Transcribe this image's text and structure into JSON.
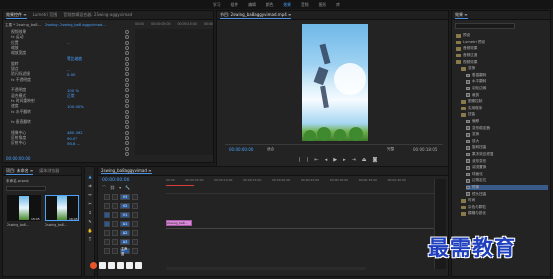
{
  "workspace_menu": [
    "学习",
    "组件",
    "编辑",
    "颜色",
    "效果",
    "音频",
    "图形",
    "库"
  ],
  "workspace_active": 4,
  "effect_controls": {
    "tabs": [
      "效果控件 ≡",
      "Lumetri 范围",
      "音频剪辑混合器: 2Swing-aggyvimad"
    ],
    "source_clip": "主要 * 2swing_ba8...",
    "seq_clip": "2swing: 2swing_ba8 aggyvimad...",
    "times": [
      "00:00",
      "00:00:05:00",
      "00:00:10:00",
      "00:00"
    ],
    "rows": [
      {
        "label": "视频效果",
        "val": ""
      },
      {
        "label": "fx  运动",
        "val": ""
      },
      {
        "label": "位置",
        "val": "..."
      },
      {
        "label": "缩放",
        "val": ""
      },
      {
        "label": "缩放宽度",
        "val": ""
      },
      {
        "label": "",
        "val": "等比缩放"
      },
      {
        "label": "旋转",
        "val": ""
      },
      {
        "label": "锚点",
        "val": "..."
      },
      {
        "label": "防闪烁滤镜",
        "val": "0.00"
      },
      {
        "label": "fx  不透明度",
        "val": ""
      },
      {
        "label": "",
        "val": ""
      },
      {
        "label": "不透明度",
        "val": "100 %"
      },
      {
        "label": "混合模式",
        "val": "正常"
      },
      {
        "label": "fx  时间重映射",
        "val": ""
      },
      {
        "label": "速度",
        "val": "100.00%"
      },
      {
        "label": "fx  水平翻转",
        "val": ""
      },
      {
        "label": "",
        "val": ""
      },
      {
        "label": "fx  垂直翻转",
        "val": ""
      },
      {
        "label": "",
        "val": ""
      },
      {
        "label": "镜像中心",
        "val": "480  492"
      },
      {
        "label": "反射角度",
        "val": "90.0°"
      },
      {
        "label": "反射中心",
        "val": "56.8 ..."
      },
      {
        "label": "",
        "val": ""
      },
      {
        "label": "",
        "val": ""
      }
    ],
    "timecode": "00:00:00:00"
  },
  "program_monitor": {
    "tab": "节目: 2swing_ba8aggyvimad.mp4 ≡",
    "timecode_left": "00:00:00:00",
    "fit": "适合",
    "full": "完整",
    "timecode_right": "00:00:18:05"
  },
  "effects_panel": {
    "title": "效果 ≡",
    "items": [
      {
        "label": "预设",
        "type": "folder",
        "indent": 0
      },
      {
        "label": "Lumetri 预设",
        "type": "folder",
        "indent": 0
      },
      {
        "label": "音频效果",
        "type": "folder",
        "indent": 0
      },
      {
        "label": "音频过渡",
        "type": "folder",
        "indent": 0
      },
      {
        "label": "视频效果",
        "type": "folder",
        "indent": 0
      },
      {
        "label": "变换",
        "type": "folder",
        "indent": 1
      },
      {
        "label": "垂直翻转",
        "type": "fx",
        "indent": 2
      },
      {
        "label": "水平翻转",
        "type": "fx",
        "indent": 2
      },
      {
        "label": "羽化边缘",
        "type": "fx",
        "indent": 2
      },
      {
        "label": "裁剪",
        "type": "fx",
        "indent": 2
      },
      {
        "label": "图像控制",
        "type": "folder",
        "indent": 1
      },
      {
        "label": "实用程序",
        "type": "folder",
        "indent": 1
      },
      {
        "label": "扭曲",
        "type": "folder",
        "indent": 1
      },
      {
        "label": "偏移",
        "type": "fx",
        "indent": 2
      },
      {
        "label": "变形稳定器",
        "type": "fx",
        "indent": 2
      },
      {
        "label": "变换",
        "type": "fx",
        "indent": 2
      },
      {
        "label": "放大",
        "type": "fx",
        "indent": 2
      },
      {
        "label": "旋转扭曲",
        "type": "fx",
        "indent": 2
      },
      {
        "label": "果冻效应修复",
        "type": "fx",
        "indent": 2
      },
      {
        "label": "波形变形",
        "type": "fx",
        "indent": 2
      },
      {
        "label": "湍流置换",
        "type": "fx",
        "indent": 2
      },
      {
        "label": "球面化",
        "type": "fx",
        "indent": 2
      },
      {
        "label": "边角定位",
        "type": "fx",
        "indent": 2
      },
      {
        "label": "镜像",
        "type": "fx",
        "indent": 2,
        "selected": true
      },
      {
        "label": "镜头扭曲",
        "type": "fx",
        "indent": 2
      },
      {
        "label": "时间",
        "type": "folder",
        "indent": 1
      },
      {
        "label": "杂色与颗粒",
        "type": "folder",
        "indent": 1
      },
      {
        "label": "模糊与锐化",
        "type": "folder",
        "indent": 1
      }
    ]
  },
  "project_panel": {
    "tabs": [
      "项目: 未命名 ≡",
      "媒体浏览器"
    ],
    "name": "未命名.prproj",
    "thumbs": [
      "2swing_ba8...",
      "2swing_ba8..."
    ],
    "durations": [
      "18:05",
      "18:05"
    ]
  },
  "timeline": {
    "tab": "2swing_ba8aggyvimad ≡",
    "timecode": "00:00:00:00",
    "ruler": [
      "00:00",
      "00:00:05:00",
      "00:00:10:00",
      "00:00:15:00",
      "00:00:20:00",
      "00:00:25:00",
      "00:00:30:00",
      "00:00:35:00",
      "00:00:40:00"
    ],
    "tracks": [
      "V3",
      "V2",
      "V1",
      "A1",
      "A2",
      "A3",
      "主声道"
    ],
    "clip_label": "2swing_ba8..."
  },
  "watermark": "最需教育",
  "colors": {
    "accent": "#4aa3ff",
    "clip": "#d88ad8",
    "selected_fx": "#3a5a8a"
  }
}
